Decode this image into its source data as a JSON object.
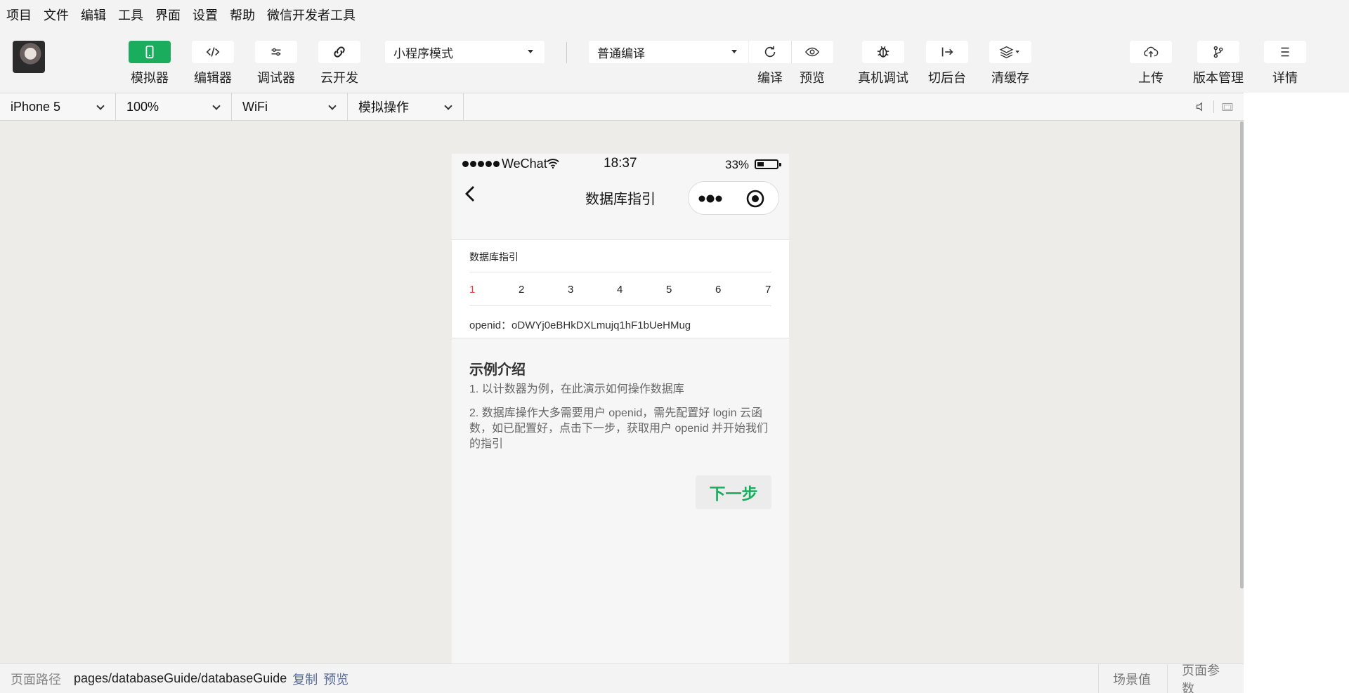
{
  "menu": [
    "项目",
    "文件",
    "编辑",
    "工具",
    "界面",
    "设置",
    "帮助",
    "微信开发者工具"
  ],
  "toolbar": {
    "simulator": "模拟器",
    "editor": "编辑器",
    "debugger": "调试器",
    "cloud": "云开发",
    "mode_select": "小程序模式",
    "compile_select": "普通编译",
    "compile": "编译",
    "preview": "预览",
    "remote_debug": "真机调试",
    "background": "切后台",
    "clear_cache": "清缓存",
    "upload": "上传",
    "version": "版本管理",
    "details": "详情",
    "accent": "#1aad5e"
  },
  "device_bar": {
    "device": "iPhone 5",
    "zoom": "100%",
    "network": "WiFi",
    "operation": "模拟操作"
  },
  "phone": {
    "status": {
      "carrier": "WeChat",
      "time": "18:37",
      "battery": "33%"
    },
    "nav_title": "数据库指引",
    "card": {
      "title": "数据库指引",
      "steps": [
        "1",
        "2",
        "3",
        "4",
        "5",
        "6",
        "7"
      ],
      "current_step": "1",
      "openid": "openid：oDWYj0eBHkDXLmujq1hF1bUeHMug"
    },
    "intro": {
      "title": "示例介绍",
      "p1": "1. 以计数器为例，在此演示如何操作数据库",
      "p2": "2. 数据库操作大多需要用户 openid，需先配置好 login 云函数，如已配置好，点击下一步，获取用户 openid 并开始我们的指引"
    },
    "next_button": "下一步"
  },
  "footer": {
    "path_label": "页面路径",
    "path": "pages/databaseGuide/databaseGuide",
    "copy": "复制",
    "preview": "预览",
    "scene": "场景值",
    "params": "页面参数"
  }
}
